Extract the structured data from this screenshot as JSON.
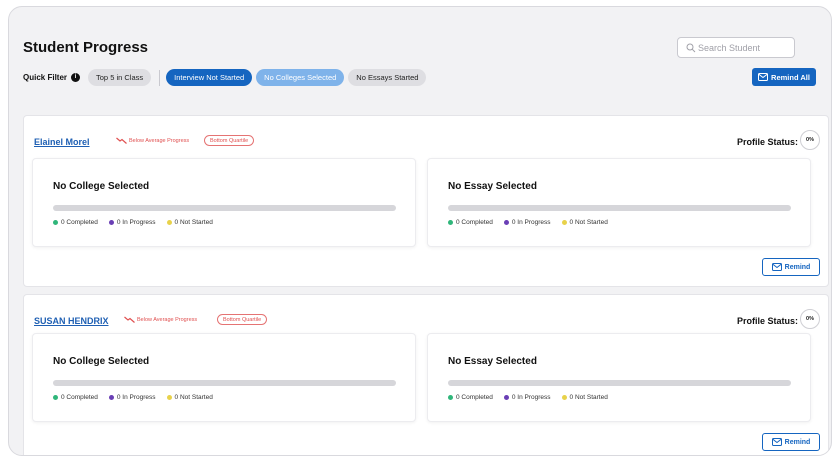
{
  "header": {
    "title": "Student Progress",
    "search_placeholder": "Search Student",
    "quick_filter_label": "Quick Filter",
    "remind_all_label": "Remind All"
  },
  "filters": [
    {
      "label": "Top 5 in Class",
      "state": "inactive"
    },
    {
      "label": "Interview Not Started",
      "state": "active"
    },
    {
      "label": "No Colleges Selected",
      "state": "active-light"
    },
    {
      "label": "No Essays Started",
      "state": "inactive"
    }
  ],
  "students": [
    {
      "name": "Elainel Morel",
      "trend": "Below Average Progress",
      "quartile": "Bottom Quartile",
      "profile_status_label": "Profile Status:",
      "profile_status_value": "0%",
      "college_panel": {
        "title": "No College Selected",
        "completed": "0 Completed",
        "in_progress": "0 In Progress",
        "not_started": "0 Not Started"
      },
      "essay_panel": {
        "title": "No Essay Selected",
        "completed": "0 Completed",
        "in_progress": "0 In Progress",
        "not_started": "0 Not Started"
      },
      "remind_label": "Remind"
    },
    {
      "name": "SUSAN HENDRIX",
      "trend": "Below Average Progress",
      "quartile": "Bottom Quartile",
      "profile_status_label": "Profile Status:",
      "profile_status_value": "0%",
      "college_panel": {
        "title": "No College Selected",
        "completed": "0 Completed",
        "in_progress": "0 In Progress",
        "not_started": "0 Not Started"
      },
      "essay_panel": {
        "title": "No Essay Selected",
        "completed": "0 Completed",
        "in_progress": "0 In Progress",
        "not_started": "0 Not Started"
      },
      "remind_label": "Remind"
    }
  ],
  "colors": {
    "primary": "#1565c0",
    "primary_light": "#7fb3ea",
    "warning_red": "#e05050",
    "completed_dot": "#2fb67a",
    "in_progress_dot": "#6a3fb5",
    "not_started_dot": "#e8d24a"
  }
}
